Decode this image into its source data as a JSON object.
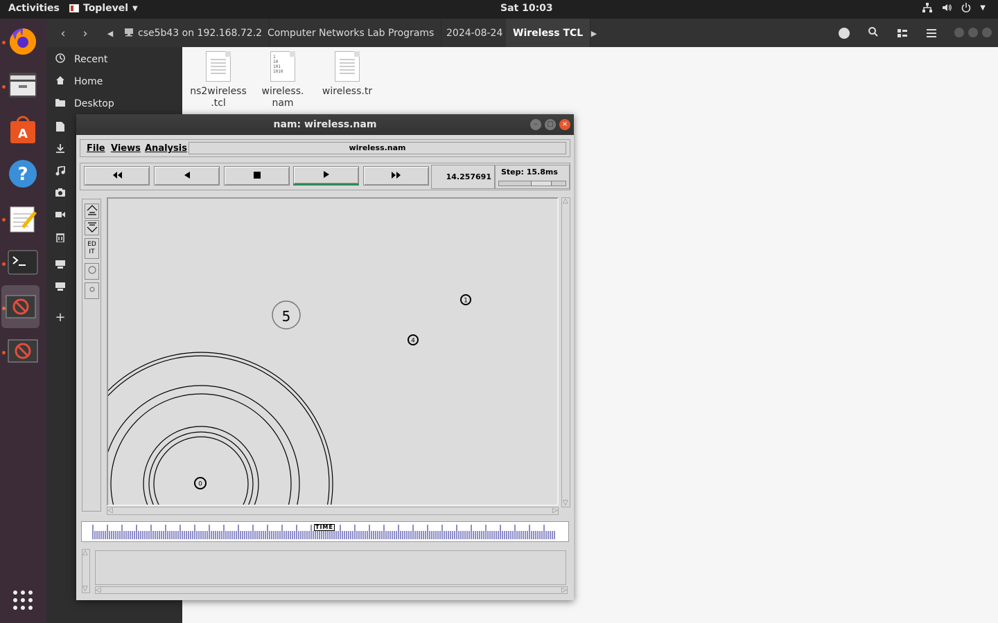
{
  "topbar": {
    "activities": "Activities",
    "app_name": "Toplevel",
    "clock": "Sat 10:03"
  },
  "dock": {
    "items": [
      "firefox-icon",
      "files-icon",
      "software-icon",
      "help-icon",
      "text-editor-icon",
      "terminal-icon",
      "nam-icon",
      "nam-icon-2",
      "show-apps-icon"
    ]
  },
  "file_manager": {
    "breadcrumbs": [
      {
        "label": "cse5b43 on 192.168.72.2"
      },
      {
        "label": "Computer Networks Lab Programs"
      },
      {
        "label": "2024-08-24"
      },
      {
        "label": "Wireless TCL"
      }
    ],
    "sidebar": [
      {
        "label": "Recent",
        "icon": "clock-icon"
      },
      {
        "label": "Home",
        "icon": "home-icon"
      },
      {
        "label": "Desktop",
        "icon": "folder-icon"
      }
    ],
    "files": [
      {
        "name_line1": "ns2wireless",
        "name_line2": ".tcl",
        "icon": "text-file-icon"
      },
      {
        "name_line1": "wireless.",
        "name_line2": "nam",
        "icon": "binary-file-icon"
      },
      {
        "name_line1": "wireless.tr",
        "name_line2": "",
        "icon": "text-file-icon"
      }
    ]
  },
  "nam": {
    "title": "nam: wireless.nam",
    "menu": {
      "file": "File",
      "views": "Views",
      "analysis": "Analysis"
    },
    "filename": "wireless.nam",
    "time": "14.257691",
    "step": "Step: 15.8ms",
    "step_fraction": 0.7,
    "timeline_label": "TIME",
    "timeline_position": 0.5,
    "nodes": [
      {
        "label": "5",
        "kind": "large"
      },
      {
        "label": "1",
        "kind": "small"
      },
      {
        "label": "4",
        "kind": "small"
      },
      {
        "label": "0",
        "kind": "small"
      }
    ],
    "edit_tool": "ED IT"
  }
}
